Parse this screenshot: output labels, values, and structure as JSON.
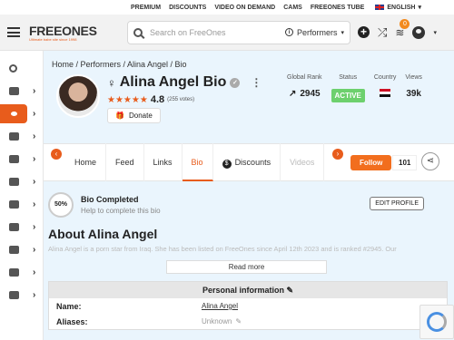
{
  "topnav": {
    "links": [
      "PREMIUM",
      "DISCOUNTS",
      "VIDEO ON DEMAND",
      "CAMS",
      "FREEONES TUBE"
    ],
    "language": "ENGLISH"
  },
  "header": {
    "logo_text": "FREEONES",
    "logo_tagline": "Ultimate babe site since 1998",
    "search_placeholder": "Search on FreeOnes",
    "search_category": "Performers",
    "coins_badge": "0"
  },
  "breadcrumb": "Home / Performers / Alina Angel / Bio",
  "profile": {
    "name": "Alina Angel Bio",
    "rating": "4.8",
    "votes": "(255 votes)",
    "donate_label": "Donate",
    "stats": {
      "global_rank_label": "Global Rank",
      "global_rank": "2945",
      "status_label": "Status",
      "status": "ACTIVE",
      "country_label": "Country",
      "views_label": "Views",
      "views": "39k"
    }
  },
  "tabs": [
    "Home",
    "Feed",
    "Links",
    "Bio",
    "Discounts",
    "Videos"
  ],
  "follow": {
    "label": "Follow",
    "count": "101"
  },
  "bio": {
    "percent": "50%",
    "title": "Bio Completed",
    "subtitle": "Help to complete this bio",
    "edit_label": "EDIT PROFILE"
  },
  "about": {
    "title": "About Alina Angel",
    "text": "Alina Angel is a porn star from Iraq. She has been listed on FreeOnes since April 12th 2023 and is ranked #2945. Our",
    "read_more": "Read more"
  },
  "personal": {
    "title": "Personal information",
    "rows": [
      {
        "key": "Name:",
        "value": "Alina Angel"
      },
      {
        "key": "Aliases:",
        "value": "Unknown"
      }
    ]
  },
  "colors": {
    "accent": "#e85c1c",
    "status_active": "#6dd06d",
    "bg_main": "#eaf5fd"
  }
}
